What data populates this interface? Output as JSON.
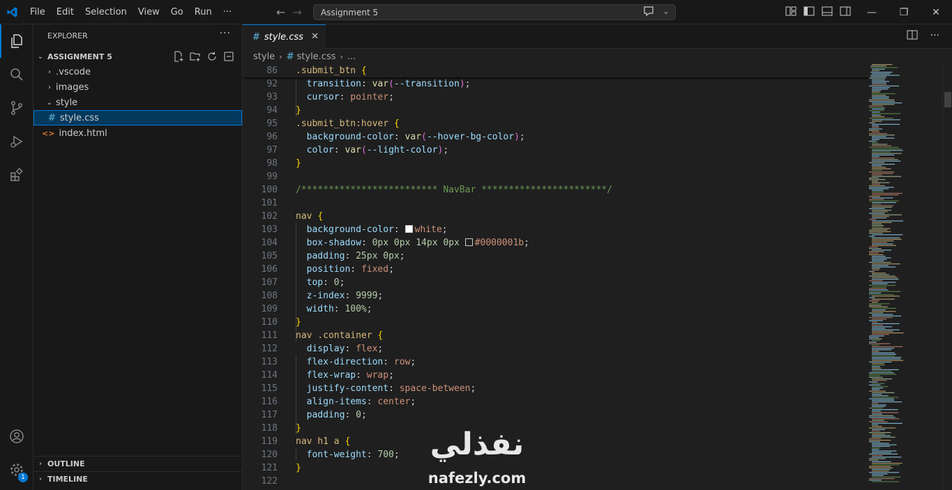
{
  "titlebar": {
    "menu": [
      "File",
      "Edit",
      "Selection",
      "View",
      "Go",
      "Run",
      "···"
    ],
    "search_text": "Assignment 5"
  },
  "sidebar": {
    "title": "EXPLORER",
    "more": "···",
    "workspace": "ASSIGNMENT 5",
    "tree": [
      {
        "label": ".vscode",
        "type": "folder",
        "expanded": false
      },
      {
        "label": "images",
        "type": "folder",
        "expanded": false
      },
      {
        "label": "style",
        "type": "folder",
        "expanded": true
      },
      {
        "label": "style.css",
        "type": "css-file",
        "selected": true
      },
      {
        "label": "index.html",
        "type": "html-file"
      }
    ],
    "outline": "OUTLINE",
    "timeline": "TIMELINE"
  },
  "activity": {
    "settings_badge": "1"
  },
  "editor": {
    "tab_label": "style.css",
    "breadcrumb": [
      "style",
      "style.css",
      "..."
    ]
  },
  "code": [
    {
      "n": "86",
      "tokens": [
        [
          "sel",
          ".submit_btn"
        ],
        [
          "punct",
          " "
        ],
        [
          "brace",
          "{"
        ]
      ]
    },
    {
      "n": "92",
      "tokens": [
        [
          "punct",
          "  "
        ],
        [
          "prop",
          "transition"
        ],
        [
          "punct",
          ": "
        ],
        [
          "fn",
          "var"
        ],
        [
          "paren",
          "("
        ],
        [
          "prop",
          "--transition"
        ],
        [
          "paren",
          ")"
        ],
        [
          "punct",
          ";"
        ]
      ]
    },
    {
      "n": "93",
      "tokens": [
        [
          "punct",
          "  "
        ],
        [
          "prop",
          "cursor"
        ],
        [
          "punct",
          ": "
        ],
        [
          "val",
          "pointer"
        ],
        [
          "punct",
          ";"
        ]
      ]
    },
    {
      "n": "94",
      "tokens": [
        [
          "brace",
          "}"
        ]
      ]
    },
    {
      "n": "95",
      "tokens": [
        [
          "sel",
          ".submit_btn:hover"
        ],
        [
          "punct",
          " "
        ],
        [
          "brace",
          "{"
        ]
      ]
    },
    {
      "n": "96",
      "tokens": [
        [
          "punct",
          "  "
        ],
        [
          "prop",
          "background-color"
        ],
        [
          "punct",
          ": "
        ],
        [
          "fn",
          "var"
        ],
        [
          "paren",
          "("
        ],
        [
          "prop",
          "--hover-bg-color"
        ],
        [
          "paren",
          ")"
        ],
        [
          "punct",
          ";"
        ]
      ]
    },
    {
      "n": "97",
      "tokens": [
        [
          "punct",
          "  "
        ],
        [
          "prop",
          "color"
        ],
        [
          "punct",
          ": "
        ],
        [
          "fn",
          "var"
        ],
        [
          "paren",
          "("
        ],
        [
          "prop",
          "--light-color"
        ],
        [
          "paren",
          ")"
        ],
        [
          "punct",
          ";"
        ]
      ]
    },
    {
      "n": "98",
      "tokens": [
        [
          "brace",
          "}"
        ]
      ]
    },
    {
      "n": "99",
      "tokens": []
    },
    {
      "n": "100",
      "tokens": [
        [
          "cmt",
          "/************************* NavBar ***********************/"
        ]
      ]
    },
    {
      "n": "101",
      "tokens": []
    },
    {
      "n": "102",
      "tokens": [
        [
          "sel",
          "nav"
        ],
        [
          "punct",
          " "
        ],
        [
          "brace",
          "{"
        ]
      ]
    },
    {
      "n": "103",
      "tokens": [
        [
          "punct",
          "  "
        ],
        [
          "prop",
          "background-color"
        ],
        [
          "punct",
          ": "
        ],
        [
          "swatch-white",
          ""
        ],
        [
          "val",
          "white"
        ],
        [
          "punct",
          ";"
        ]
      ]
    },
    {
      "n": "104",
      "tokens": [
        [
          "punct",
          "  "
        ],
        [
          "prop",
          "box-shadow"
        ],
        [
          "punct",
          ": "
        ],
        [
          "num",
          "0px"
        ],
        [
          "punct",
          " "
        ],
        [
          "num",
          "0px"
        ],
        [
          "punct",
          " "
        ],
        [
          "num",
          "14px"
        ],
        [
          "punct",
          " "
        ],
        [
          "num",
          "0px"
        ],
        [
          "punct",
          " "
        ],
        [
          "swatch-dark",
          ""
        ],
        [
          "val",
          "#0000001b"
        ],
        [
          "punct",
          ";"
        ]
      ]
    },
    {
      "n": "105",
      "tokens": [
        [
          "punct",
          "  "
        ],
        [
          "prop",
          "padding"
        ],
        [
          "punct",
          ": "
        ],
        [
          "num",
          "25px"
        ],
        [
          "punct",
          " "
        ],
        [
          "num",
          "0px"
        ],
        [
          "punct",
          ";"
        ]
      ]
    },
    {
      "n": "106",
      "tokens": [
        [
          "punct",
          "  "
        ],
        [
          "prop",
          "position"
        ],
        [
          "punct",
          ": "
        ],
        [
          "val",
          "fixed"
        ],
        [
          "punct",
          ";"
        ]
      ]
    },
    {
      "n": "107",
      "tokens": [
        [
          "punct",
          "  "
        ],
        [
          "prop",
          "top"
        ],
        [
          "punct",
          ": "
        ],
        [
          "num",
          "0"
        ],
        [
          "punct",
          ";"
        ]
      ]
    },
    {
      "n": "108",
      "tokens": [
        [
          "punct",
          "  "
        ],
        [
          "prop",
          "z-index"
        ],
        [
          "punct",
          ": "
        ],
        [
          "num",
          "9999"
        ],
        [
          "punct",
          ";"
        ]
      ]
    },
    {
      "n": "109",
      "tokens": [
        [
          "punct",
          "  "
        ],
        [
          "prop",
          "width"
        ],
        [
          "punct",
          ": "
        ],
        [
          "num",
          "100%"
        ],
        [
          "punct",
          ";"
        ]
      ]
    },
    {
      "n": "110",
      "tokens": [
        [
          "brace",
          "}"
        ]
      ]
    },
    {
      "n": "111",
      "tokens": [
        [
          "sel",
          "nav .container"
        ],
        [
          "punct",
          " "
        ],
        [
          "brace",
          "{"
        ]
      ]
    },
    {
      "n": "112",
      "tokens": [
        [
          "punct",
          "  "
        ],
        [
          "prop",
          "display"
        ],
        [
          "punct",
          ": "
        ],
        [
          "val",
          "flex"
        ],
        [
          "punct",
          ";"
        ]
      ]
    },
    {
      "n": "113",
      "tokens": [
        [
          "punct",
          "  "
        ],
        [
          "prop",
          "flex-direction"
        ],
        [
          "punct",
          ": "
        ],
        [
          "val",
          "row"
        ],
        [
          "punct",
          ";"
        ]
      ]
    },
    {
      "n": "114",
      "tokens": [
        [
          "punct",
          "  "
        ],
        [
          "prop",
          "flex-wrap"
        ],
        [
          "punct",
          ": "
        ],
        [
          "val",
          "wrap"
        ],
        [
          "punct",
          ";"
        ]
      ]
    },
    {
      "n": "115",
      "tokens": [
        [
          "punct",
          "  "
        ],
        [
          "prop",
          "justify-content"
        ],
        [
          "punct",
          ": "
        ],
        [
          "val",
          "space-between"
        ],
        [
          "punct",
          ";"
        ]
      ]
    },
    {
      "n": "116",
      "tokens": [
        [
          "punct",
          "  "
        ],
        [
          "prop",
          "align-items"
        ],
        [
          "punct",
          ": "
        ],
        [
          "val",
          "center"
        ],
        [
          "punct",
          ";"
        ]
      ]
    },
    {
      "n": "117",
      "tokens": [
        [
          "punct",
          "  "
        ],
        [
          "prop",
          "padding"
        ],
        [
          "punct",
          ": "
        ],
        [
          "num",
          "0"
        ],
        [
          "punct",
          ";"
        ]
      ]
    },
    {
      "n": "118",
      "tokens": [
        [
          "brace",
          "}"
        ]
      ]
    },
    {
      "n": "119",
      "tokens": [
        [
          "sel",
          "nav h1 a"
        ],
        [
          "punct",
          " "
        ],
        [
          "brace",
          "{"
        ]
      ]
    },
    {
      "n": "120",
      "tokens": [
        [
          "punct",
          "  "
        ],
        [
          "prop",
          "font-weight"
        ],
        [
          "punct",
          ": "
        ],
        [
          "num",
          "700"
        ],
        [
          "punct",
          ";"
        ]
      ]
    },
    {
      "n": "121",
      "tokens": [
        [
          "brace",
          "}"
        ]
      ]
    },
    {
      "n": "122",
      "tokens": []
    }
  ],
  "watermark": {
    "arabic": "نفذلي",
    "url": "nafezly.com"
  }
}
